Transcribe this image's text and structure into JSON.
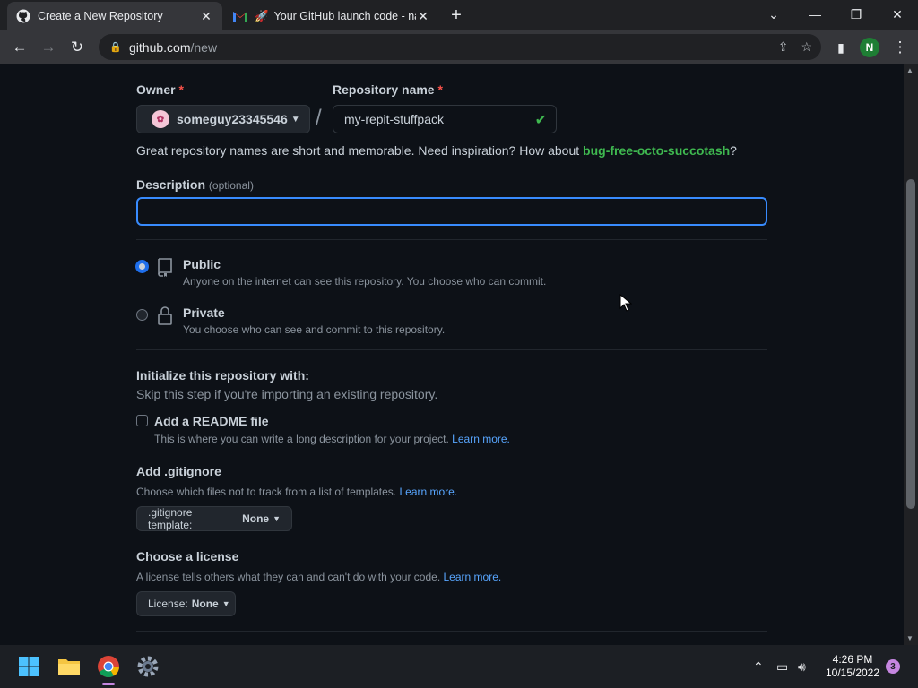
{
  "browser": {
    "tabs": [
      {
        "title": "Create a New Repository",
        "icon": "github-icon",
        "active": true
      },
      {
        "title": "Your GitHub launch code - na",
        "icon": "gmail-icon",
        "active": false
      }
    ],
    "url_host": "github.com",
    "url_path": "/new",
    "profile_initial": "N"
  },
  "form": {
    "owner_label": "Owner",
    "owner_required": "*",
    "owner_value": "someguy23345546",
    "separator": "/",
    "repo_label": "Repository name",
    "repo_required": "*",
    "repo_value": "my-repit-stuffpack",
    "hint_text": "Great repository names are short and memorable. Need inspiration? How about ",
    "hint_suggestion": "bug-free-octo-succotash",
    "hint_end": "?",
    "description_label": "Description",
    "description_optional": "(optional)",
    "description_value": "",
    "visibility": {
      "public_label": "Public",
      "public_desc": "Anyone on the internet can see this repository. You choose who can commit.",
      "private_label": "Private",
      "private_desc": "You choose who can see and commit to this repository.",
      "selected": "public"
    },
    "init_heading": "Initialize this repository with:",
    "init_subtext": "Skip this step if you're importing an existing repository.",
    "readme_label": "Add a README file",
    "readme_desc": "This is where you can write a long description for your project.",
    "readme_link": "Learn more.",
    "gitignore_heading": "Add .gitignore",
    "gitignore_desc": "Choose which files not to track from a list of templates.",
    "gitignore_link": "Learn more.",
    "gitignore_prefix": ".gitignore template:",
    "gitignore_value": "None",
    "license_heading": "Choose a license",
    "license_desc": "A license tells others what they can and can't do with your code.",
    "license_link": "Learn more.",
    "license_prefix": "License:",
    "license_value": "None"
  },
  "taskbar": {
    "time": "4:26 PM",
    "date": "10/15/2022",
    "notifications": "3"
  }
}
